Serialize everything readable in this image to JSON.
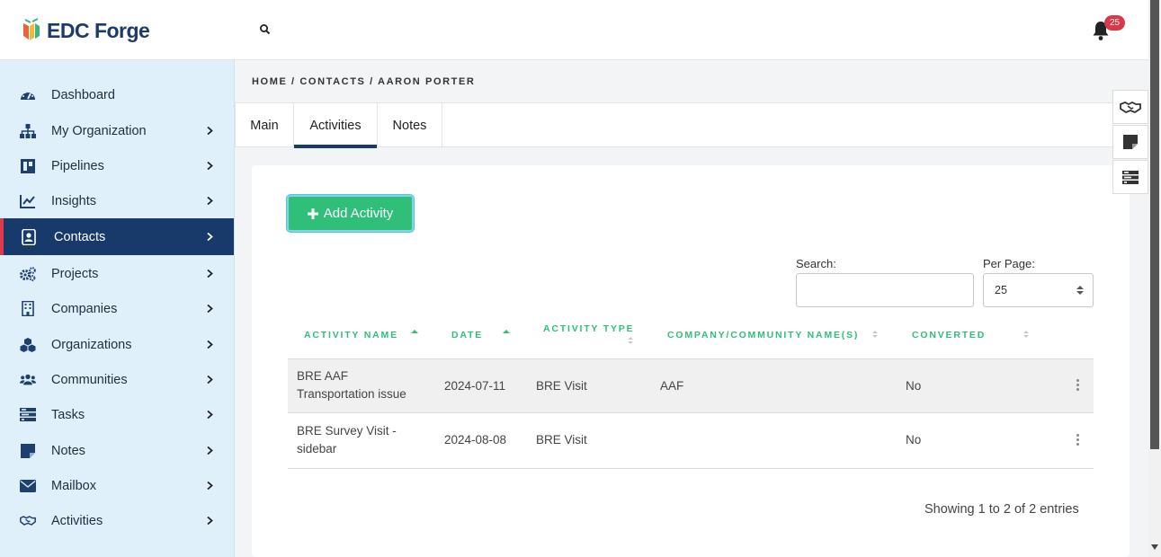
{
  "app": {
    "brand": "EDC Forge",
    "notifications_count": "25"
  },
  "breadcrumb": "HOME / CONTACTS / AARON PORTER",
  "sidebar": {
    "items": [
      {
        "label": "Dashboard",
        "icon": "dashboard-icon",
        "has_children": false,
        "active": false
      },
      {
        "label": "My Organization",
        "icon": "org-chart-icon",
        "has_children": true,
        "active": false
      },
      {
        "label": "Pipelines",
        "icon": "pipeline-icon",
        "has_children": true,
        "active": false
      },
      {
        "label": "Insights",
        "icon": "chart-line-icon",
        "has_children": true,
        "active": false
      },
      {
        "label": "Contacts",
        "icon": "contact-card-icon",
        "has_children": true,
        "active": true
      },
      {
        "label": "Projects",
        "icon": "gears-icon",
        "has_children": true,
        "active": false
      },
      {
        "label": "Companies",
        "icon": "building-icon",
        "has_children": true,
        "active": false
      },
      {
        "label": "Organizations",
        "icon": "cubes-icon",
        "has_children": true,
        "active": false
      },
      {
        "label": "Communities",
        "icon": "users-icon",
        "has_children": true,
        "active": false
      },
      {
        "label": "Tasks",
        "icon": "tasks-icon",
        "has_children": true,
        "active": false
      },
      {
        "label": "Notes",
        "icon": "note-icon",
        "has_children": true,
        "active": false
      },
      {
        "label": "Mailbox",
        "icon": "envelope-icon",
        "has_children": true,
        "active": false
      },
      {
        "label": "Activities",
        "icon": "handshake-icon",
        "has_children": true,
        "active": false
      }
    ]
  },
  "tabs": [
    {
      "label": "Main",
      "active": false
    },
    {
      "label": "Activities",
      "active": true
    },
    {
      "label": "Notes",
      "active": false
    }
  ],
  "activities": {
    "add_button": "Add Activity",
    "search_label": "Search:",
    "search_value": "",
    "per_page_label": "Per Page:",
    "per_page_value": "25",
    "columns": [
      "ACTIVITY NAME",
      "DATE",
      "ACTIVITY TYPE",
      "COMPANY/COMMUNITY NAME(S)",
      "CONVERTED"
    ],
    "rows": [
      {
        "name_line1": "BRE AAF",
        "name_line2": "Transportation issue",
        "date": "2024-07-11",
        "type": "BRE Visit",
        "company": "AAF",
        "converted": "No"
      },
      {
        "name_line1": "BRE Survey Visit -",
        "name_line2": "sidebar",
        "date": "2024-08-08",
        "type": "BRE Visit",
        "company": "",
        "converted": "No"
      }
    ],
    "info": "Showing 1 to 2 of 2 entries"
  },
  "colors": {
    "navy": "#173a6a",
    "accent_green": "#2fbf79",
    "badge_red": "#d9374a",
    "sidebar_bg": "#dff0fb"
  }
}
